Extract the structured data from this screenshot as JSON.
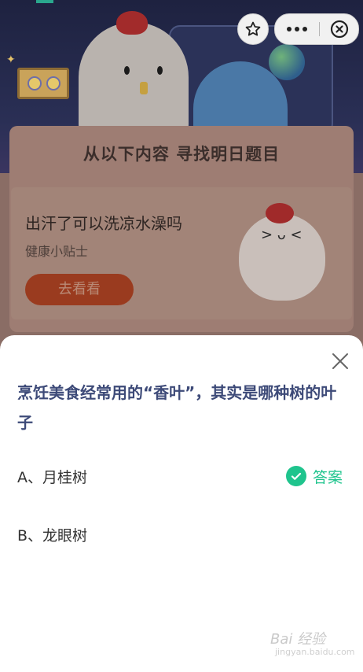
{
  "banner": {
    "title": "从以下内容  寻找明日题目"
  },
  "tip_card": {
    "title": "出汗了可以洗凉水澡吗",
    "subtitle": "健康小贴士",
    "button_label": "去看看"
  },
  "controls": {
    "favorite_icon": "star-outline-icon",
    "more_icon": "more-dots-icon",
    "close_icon": "close-circle-icon"
  },
  "quiz": {
    "question": "烹饪美食经常用的“香叶”，其实是哪种树的叶子",
    "options": [
      {
        "label": "A、月桂树",
        "is_answer": true
      },
      {
        "label": "B、龙眼树",
        "is_answer": false
      }
    ],
    "answer_label": "答案",
    "answer_color": "#1fc48d"
  },
  "watermark": {
    "text": "Bai 经验",
    "sub": "jingyan.baidu.com"
  }
}
